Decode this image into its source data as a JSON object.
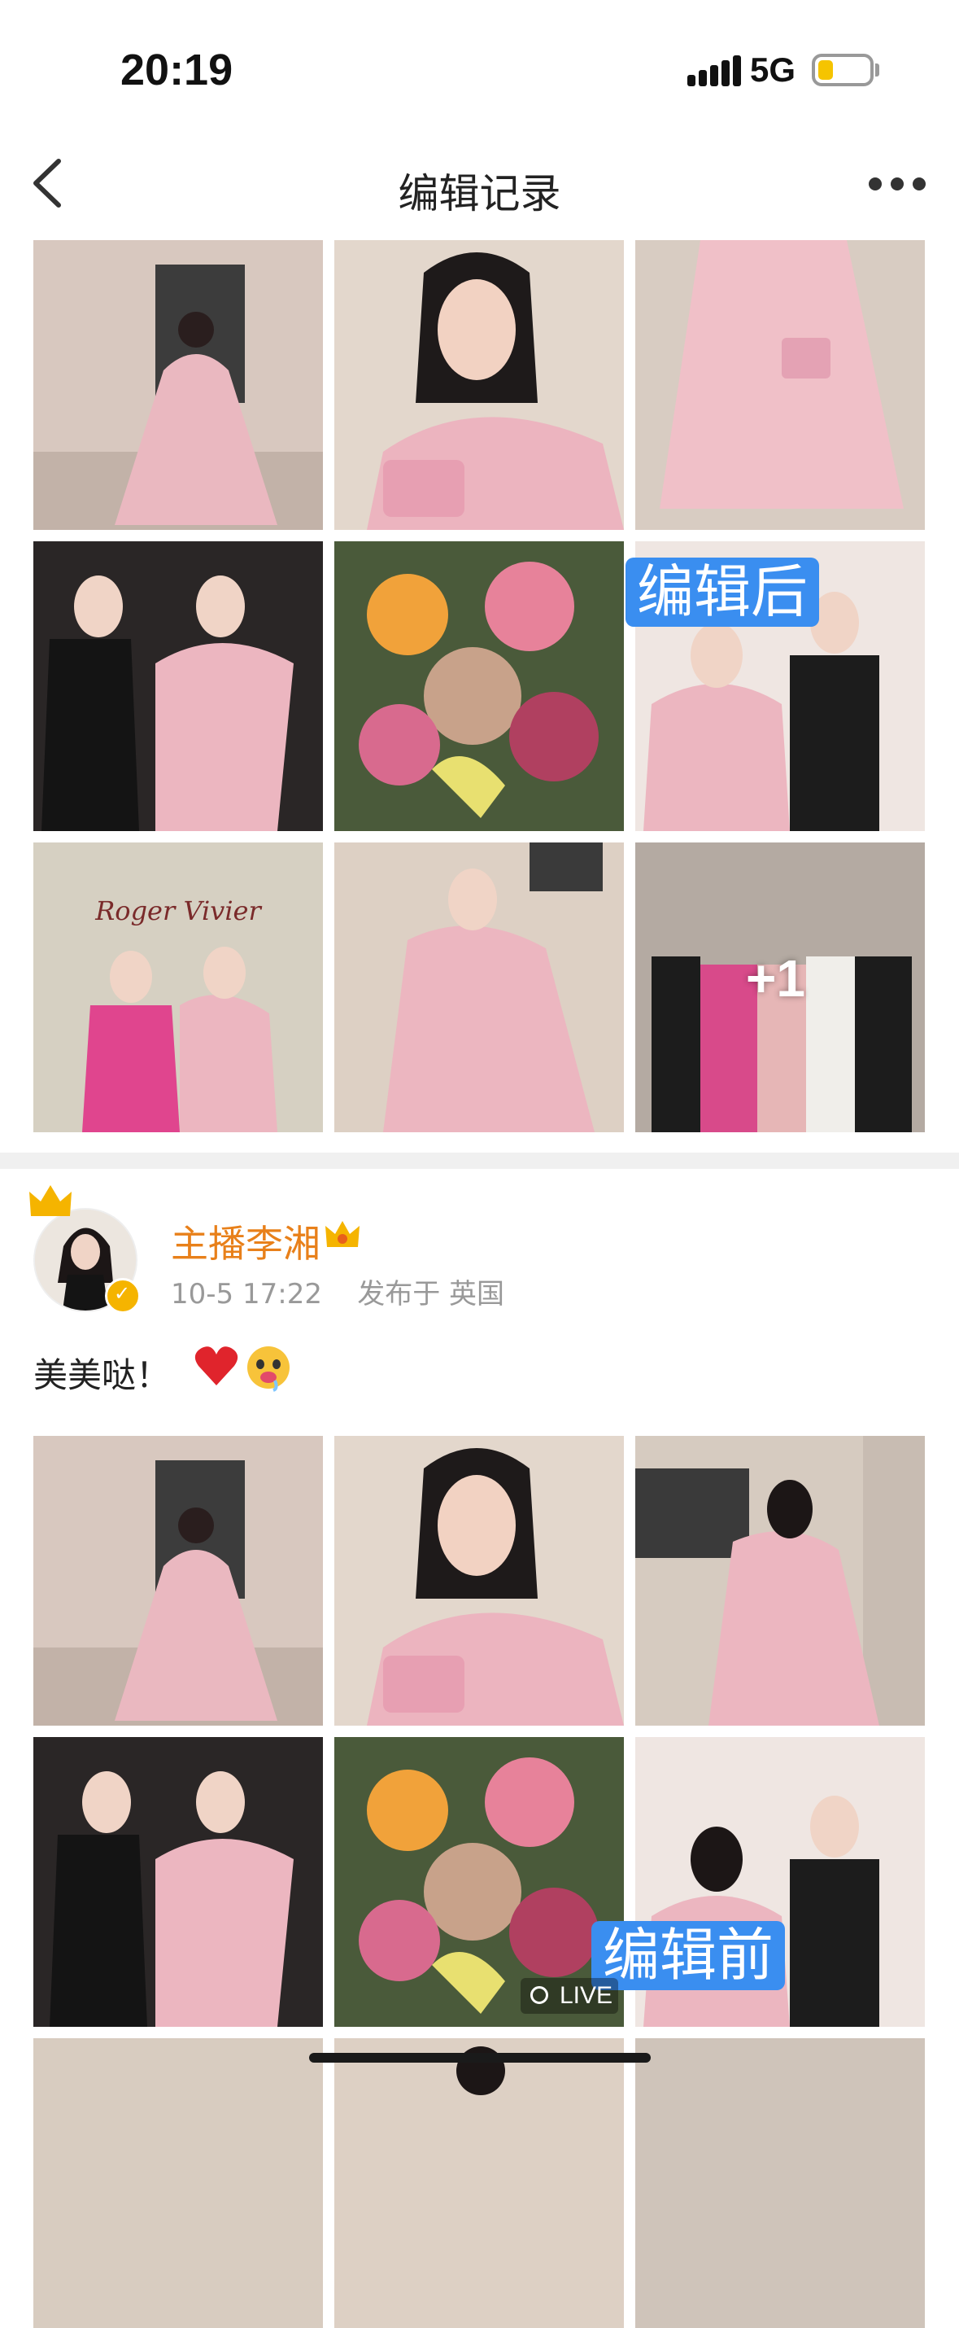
{
  "status_bar": {
    "time": "20:19",
    "network": "5G"
  },
  "nav": {
    "title": "编辑记录",
    "back_icon": "chevron-left-icon",
    "more_icon": "ellipsis-icon"
  },
  "edited_post": {
    "badge": "编辑后",
    "extra_count": "+1",
    "photos": [
      "woman-pink-gown-full-body",
      "woman-pink-gown-portrait-handbag",
      "pink-gown-skirt-closeup",
      "two-women-black-and-pink-dress",
      "flower-bouquet",
      "woman-pink-dress-with-man",
      "two-women-roger-vivier-backdrop",
      "woman-pink-gown-street",
      "group-photo-five-people"
    ],
    "backdrop_text": "Roger Vivier"
  },
  "original_post": {
    "author": "主播李湘",
    "time": "10-5 17:22",
    "location": "发布于 英国",
    "text": "美美哒！",
    "badge": "编辑前",
    "live_label": "LIVE",
    "colors": {
      "author": "#e8801a",
      "badge": "#3a8ef0",
      "verified": "#f5b400"
    }
  }
}
